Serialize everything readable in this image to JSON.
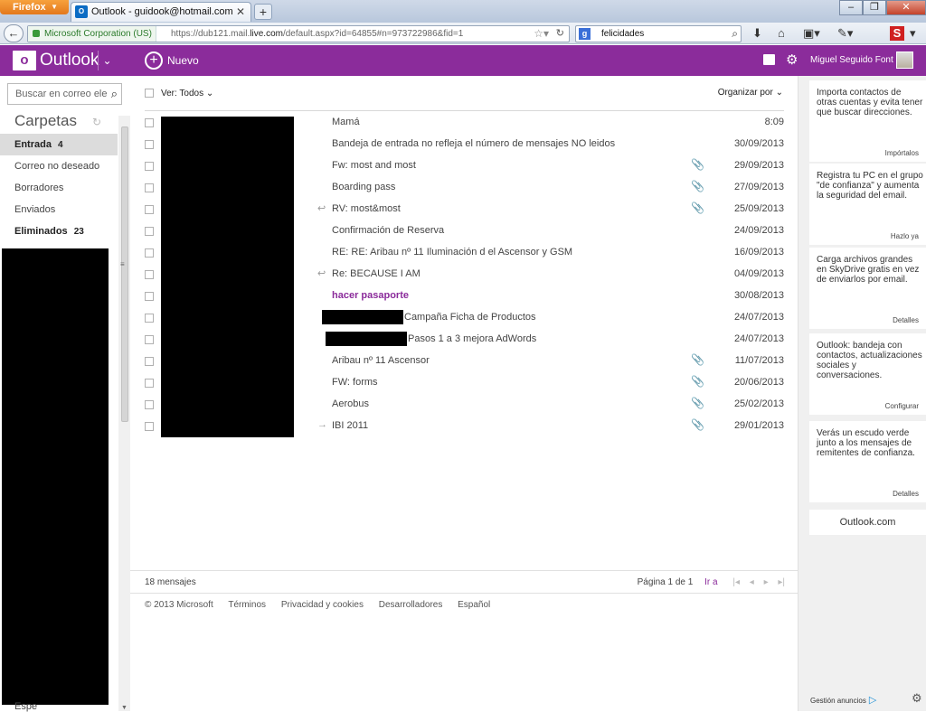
{
  "browser": {
    "app_button": "Firefox",
    "tab_title": "Outlook - guidook@hotmail.com",
    "identity": "Microsoft Corporation (US)",
    "url_prefix": "https://dub121.mail.",
    "url_domain": "live.com",
    "url_rest": "/default.aspx?id=64855#n=973722986&fid=1",
    "search_value": "felicidades"
  },
  "header": {
    "logo_letter": "o",
    "app_name": "Outlook",
    "new_label": "Nuevo",
    "user_name": "Miguel Seguido Font"
  },
  "sidebar": {
    "search_placeholder": "Buscar en correo ele",
    "title": "Carpetas",
    "folders": [
      {
        "label": "Entrada",
        "count": "4"
      },
      {
        "label": "Correo no deseado",
        "count": ""
      },
      {
        "label": "Borradores",
        "count": ""
      },
      {
        "label": "Enviados",
        "count": ""
      },
      {
        "label": "Eliminados",
        "count": "23"
      }
    ],
    "bottom_partial": "Espe"
  },
  "list": {
    "view_label": "Ver: Todos",
    "organize_label": "Organizar por",
    "messages": [
      {
        "subject": "Mamá",
        "date": "8:09",
        "attach": false,
        "status": "",
        "unread": false
      },
      {
        "subject": "Bandeja de entrada no refleja el número de mensajes NO leidos",
        "date": "30/09/2013",
        "attach": false,
        "status": "",
        "unread": false
      },
      {
        "subject": "Fw: most and most",
        "date": "29/09/2013",
        "attach": true,
        "status": "",
        "unread": false
      },
      {
        "subject": "Boarding pass",
        "date": "27/09/2013",
        "attach": true,
        "status": "",
        "unread": false
      },
      {
        "subject": "RV: most&most",
        "date": "25/09/2013",
        "attach": true,
        "status": "reply",
        "unread": false
      },
      {
        "subject": "Confirmación de Reserva",
        "date": "24/09/2013",
        "attach": false,
        "status": "",
        "unread": false
      },
      {
        "subject": "RE: RE: Aribau nº 11 Iluminación d el Ascensor y GSM",
        "date": "16/09/2013",
        "attach": false,
        "status": "",
        "unread": false
      },
      {
        "subject": "Re: BECAUSE I AM",
        "date": "04/09/2013",
        "attach": false,
        "status": "reply",
        "unread": false
      },
      {
        "subject": "hacer pasaporte",
        "date": "30/08/2013",
        "attach": false,
        "status": "",
        "unread": true
      },
      {
        "subject": "Campaña Ficha de Productos",
        "date": "24/07/2013",
        "attach": false,
        "status": "",
        "unread": false
      },
      {
        "subject": "Pasos 1 a 3 mejora AdWords",
        "date": "24/07/2013",
        "attach": false,
        "status": "",
        "unread": false
      },
      {
        "subject": "Aribau nº 11 Ascensor",
        "date": "11/07/2013",
        "attach": true,
        "status": "",
        "unread": false
      },
      {
        "subject": "FW: forms",
        "date": "20/06/2013",
        "attach": true,
        "status": "",
        "unread": false
      },
      {
        "subject": "Aerobus",
        "date": "25/02/2013",
        "attach": true,
        "status": "",
        "unread": false
      },
      {
        "subject": "IBI 2011",
        "date": "29/01/2013",
        "attach": true,
        "status": "forward",
        "unread": false
      }
    ],
    "count_label": "18 mensajes",
    "page_label": "Página 1 de 1",
    "goto_label": "Ir a"
  },
  "footer": {
    "links": [
      "© 2013 Microsoft",
      "Términos",
      "Privacidad y cookies",
      "Desarrolladores",
      "Español"
    ]
  },
  "ads": [
    {
      "text": "Importa contactos de otras cuentas y evita tener que buscar direcciones.",
      "link": "Impórtalos"
    },
    {
      "text": "Registra tu PC en el grupo \"de confianza\" y aumenta la seguridad del email.",
      "link": "Hazlo ya"
    },
    {
      "text": "Carga archivos grandes en SkyDrive gratis en vez de enviarlos por email.",
      "link": "Detalles"
    },
    {
      "text": "Outlook: bandeja con contactos, actualizaciones sociales y conversaciones.",
      "link": "Configurar"
    },
    {
      "text": "Verás un escudo verde junto a los mensajes de remitentes de confianza.",
      "link": "Detalles"
    }
  ],
  "right_bottom": {
    "brand": "Outlook.com",
    "manage_ads": "Gestión anuncios"
  },
  "colors": {
    "brand_purple": "#8b2c9b",
    "unread_text": "#8b2c9b"
  }
}
